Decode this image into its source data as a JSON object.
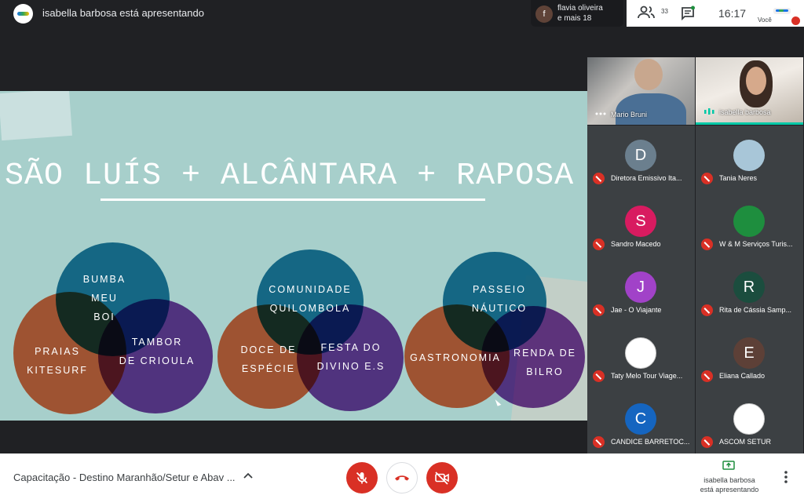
{
  "header": {
    "presenting_title": "isabella barbosa está apresentando",
    "active_speaker": {
      "initial": "f",
      "line1": "flavia oliveira",
      "line2": "e mais 18"
    },
    "people_count": "33",
    "time": "16:17",
    "self_label": "Você"
  },
  "slide": {
    "title": "SÃO LUÍS + ALCÂNTARA + RAPOSA",
    "circle_labels": [
      "BUMBA\nMEU\nBOI",
      "PRAIAS\nKITESURF",
      "TAMBOR\nDE CRIOULA",
      "COMUNIDADE\nQUILOMBOLA",
      "DOCE DE\nESPÉCIE",
      "FESTA DO\nDIVINO E.S",
      "PASSEIO\nNÁUTICO",
      "GASTRONOMIA",
      "RENDA DE\nBILRO"
    ]
  },
  "video_tiles": [
    {
      "name": "Mario Bruni"
    },
    {
      "name": "isabella barbosa"
    }
  ],
  "participants": [
    {
      "name": "Diretora Emissivo Ita...",
      "initial": "D",
      "color": "#6b7f8e"
    },
    {
      "name": "Tania Neres",
      "initial": "",
      "color": "#a8c6d8"
    },
    {
      "name": "Sandro Macedo",
      "initial": "S",
      "color": "#d81b60"
    },
    {
      "name": "W & M Serviços Turis...",
      "initial": "",
      "color": "#1e8e3e"
    },
    {
      "name": "Jae - O Viajante",
      "initial": "J",
      "color": "#a142c8"
    },
    {
      "name": "Rita de Cássia Samp...",
      "initial": "R",
      "color": "#1b4d3e"
    },
    {
      "name": "Taty Melo Tour Viage...",
      "initial": "",
      "color": "#ffffff"
    },
    {
      "name": "Eliana Callado",
      "initial": "E",
      "color": "#5d4037"
    },
    {
      "name": "CANDICE BARRETOC...",
      "initial": "C",
      "color": "#1565c0"
    },
    {
      "name": "ASCOM SETUR",
      "initial": "",
      "color": "#ffffff"
    }
  ],
  "footer": {
    "meeting_title": "Capacitação - Destino Maranhão/Setur e Abav ...",
    "presenting_line1": "isabella barbosa",
    "presenting_line2": "está apresentando"
  },
  "colors": {
    "slide_bg": "#a7cfcb",
    "circle_blue": "#1f7fa6",
    "circle_orange": "#f2663e",
    "circle_purple": "#7a3e9e",
    "mute_red": "#d93025"
  }
}
